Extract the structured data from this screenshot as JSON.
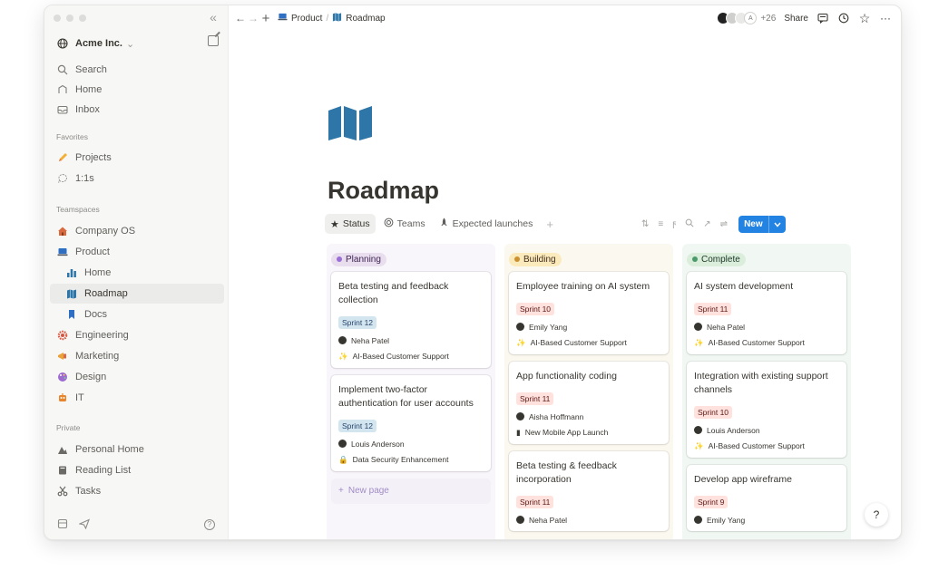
{
  "sidebar": {
    "workspace": "Acme Inc.",
    "top_items": [
      {
        "label": "Search",
        "icon": "search-icon"
      },
      {
        "label": "Home",
        "icon": "home-icon"
      },
      {
        "label": "Inbox",
        "icon": "inbox-icon"
      }
    ],
    "favorites_label": "Favorites",
    "favorites": [
      {
        "label": "Projects",
        "icon": "pencil-icon"
      },
      {
        "label": "1:1s",
        "icon": "chat-bubble-icon"
      }
    ],
    "teamspaces_label": "Teamspaces",
    "teamspaces": [
      {
        "label": "Company OS",
        "icon": "house-icon"
      },
      {
        "label": "Product",
        "icon": "laptop-icon"
      },
      {
        "label": "Home",
        "icon": "chart-icon"
      },
      {
        "label": "Roadmap",
        "icon": "map-icon"
      },
      {
        "label": "Docs",
        "icon": "bookmark-icon"
      },
      {
        "label": "Engineering",
        "icon": "gear-icon"
      },
      {
        "label": "Marketing",
        "icon": "megaphone-icon"
      },
      {
        "label": "Design",
        "icon": "palette-icon"
      },
      {
        "label": "IT",
        "icon": "robot-icon"
      }
    ],
    "private_label": "Private",
    "private": [
      {
        "label": "Personal Home",
        "icon": "mountain-icon"
      },
      {
        "label": "Reading List",
        "icon": "book-icon"
      },
      {
        "label": "Tasks",
        "icon": "scissors-icon"
      }
    ]
  },
  "topbar": {
    "breadcrumb_1": "Product",
    "breadcrumb_sep": "/",
    "breadcrumb_2": "Roadmap",
    "avatar_letter": "A",
    "extra_count": "+26",
    "share_label": "Share"
  },
  "page": {
    "title": "Roadmap",
    "views": [
      {
        "label": "Status",
        "icon": "star-icon"
      },
      {
        "label": "Teams",
        "icon": "target-icon"
      },
      {
        "label": "Expected launches",
        "icon": "rocket-icon"
      }
    ],
    "add_view": "+",
    "new_label": "New"
  },
  "board": {
    "columns": [
      {
        "label": "Planning",
        "cards": [
          {
            "title": "Beta testing and feedback collection",
            "sprint": "Sprint 12",
            "person": "Neha Patel",
            "project": "AI-Based Customer Support"
          },
          {
            "title": "Implement two-factor authentication for user accounts",
            "sprint": "Sprint 12",
            "person": "Louis Anderson",
            "project": "Data Security Enhancement"
          }
        ],
        "new_page": "New page"
      },
      {
        "label": "Building",
        "cards": [
          {
            "title": "Employee training on AI system",
            "sprint": "Sprint 10",
            "person": "Emily Yang",
            "project": "AI-Based Customer Support"
          },
          {
            "title": "App functionality coding",
            "sprint": "Sprint 11",
            "person": "Aisha Hoffmann",
            "project": "New Mobile App Launch"
          },
          {
            "title": "Beta testing & feedback incorporation",
            "sprint": "Sprint 11",
            "person": "Neha Patel"
          }
        ]
      },
      {
        "label": "Complete",
        "cards": [
          {
            "title": "AI system development",
            "sprint": "Sprint 11",
            "person": "Neha Patel",
            "project": "AI-Based Customer Support"
          },
          {
            "title": "Integration with existing support channels",
            "sprint": "Sprint 10",
            "person": "Louis Anderson",
            "project": "AI-Based Customer Support"
          },
          {
            "title": "Develop app wireframe",
            "sprint": "Sprint 9",
            "person": "Emily Yang"
          }
        ]
      }
    ]
  },
  "colors": {
    "accent": "#2383e2",
    "planning_bg": "#f8f5fb",
    "planning_tag": "#e8deee",
    "building_bg": "#fbf8ef",
    "building_tag": "#fbeabc",
    "complete_bg": "#f1f8f3",
    "complete_tag": "#dbeddb",
    "page_icon": "#2e76a8"
  }
}
